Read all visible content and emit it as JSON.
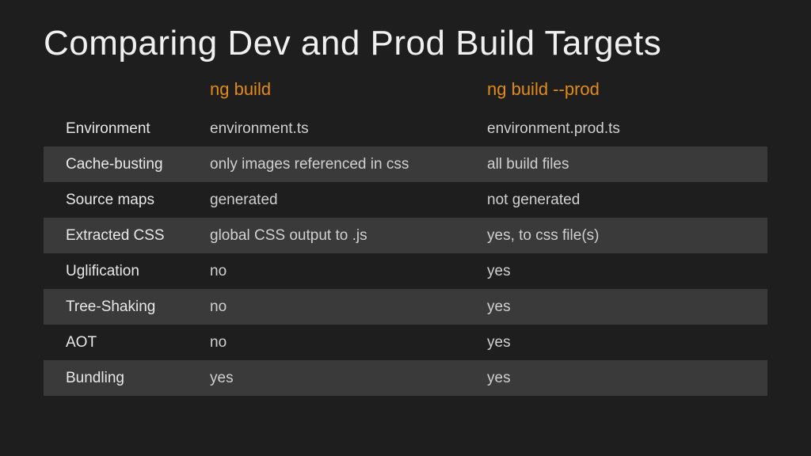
{
  "title": "Comparing Dev and Prod Build Targets",
  "columns": {
    "label": "",
    "build": "ng build",
    "prod": "ng build --prod"
  },
  "rows": [
    {
      "label": "Environment",
      "build": "environment.ts",
      "prod": "environment.prod.ts"
    },
    {
      "label": "Cache-busting",
      "build": "only images referenced in css",
      "prod": "all build files"
    },
    {
      "label": "Source maps",
      "build": "generated",
      "prod": "not generated"
    },
    {
      "label": "Extracted CSS",
      "build": "global CSS output to .js",
      "prod": "yes, to css file(s)"
    },
    {
      "label": "Uglification",
      "build": "no",
      "prod": "yes"
    },
    {
      "label": "Tree-Shaking",
      "build": "no",
      "prod": "yes"
    },
    {
      "label": "AOT",
      "build": "no",
      "prod": "yes"
    },
    {
      "label": "Bundling",
      "build": "yes",
      "prod": "yes"
    }
  ]
}
